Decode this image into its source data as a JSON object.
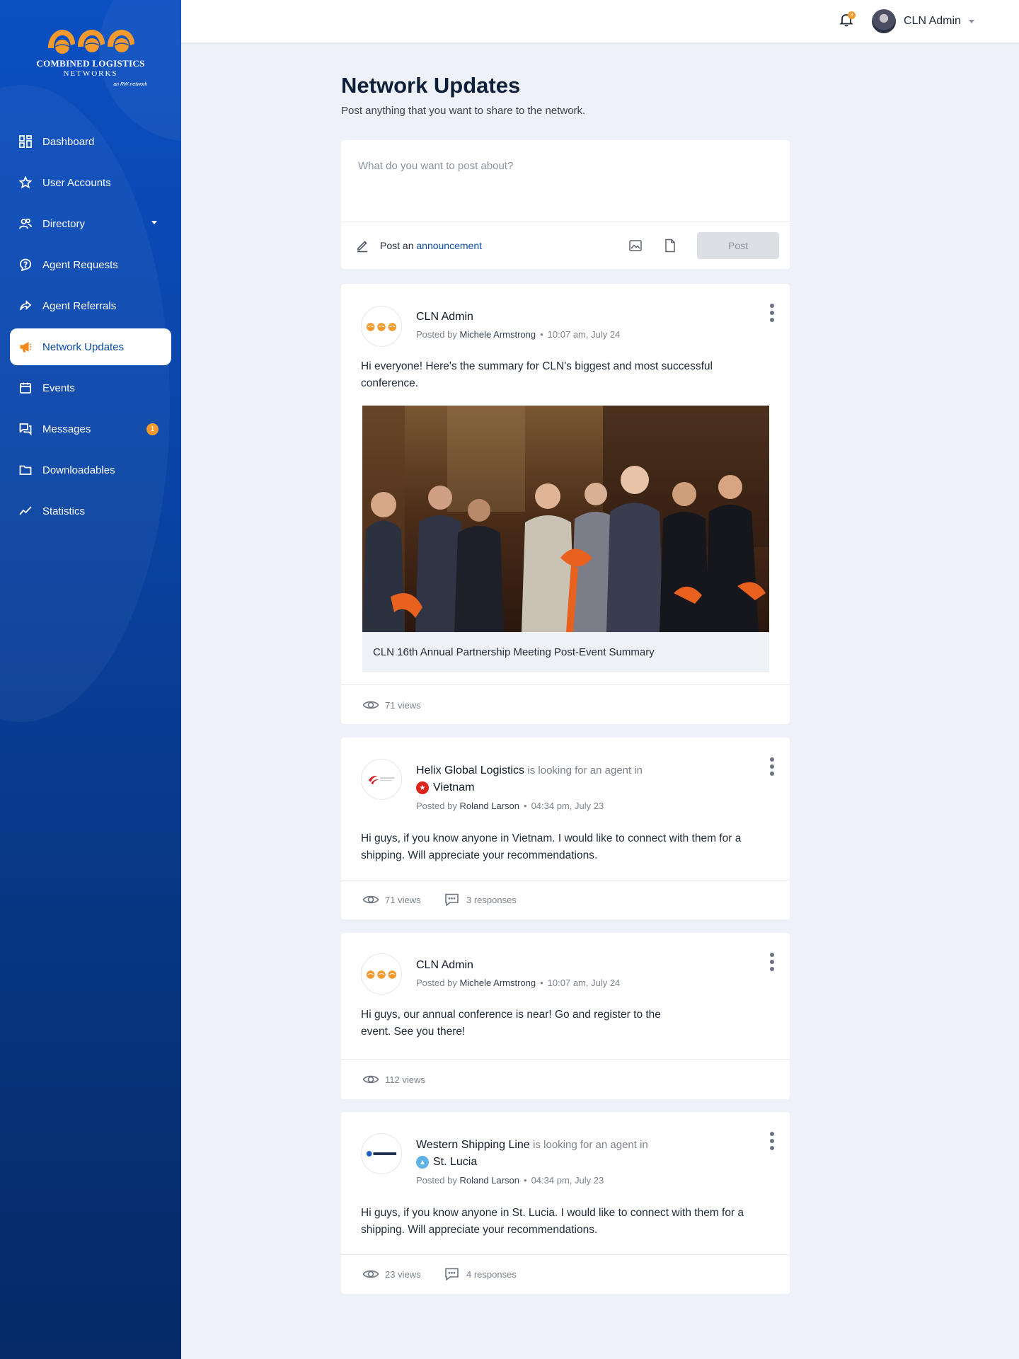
{
  "brand": {
    "line1": "COMBINED LOGISTICS",
    "line2": "NETWORKS",
    "line3": "an RW network"
  },
  "sidebar": {
    "items": [
      {
        "label": "Dashboard",
        "icon": "dashboard-icon"
      },
      {
        "label": "User Accounts",
        "icon": "star-icon"
      },
      {
        "label": "Directory",
        "icon": "people-icon"
      },
      {
        "label": "Agent Requests",
        "icon": "question-circle-icon"
      },
      {
        "label": "Agent Referrals",
        "icon": "share-arrow-icon"
      },
      {
        "label": "Network Updates",
        "icon": "megaphone-icon"
      },
      {
        "label": "Events",
        "icon": "calendar-icon"
      },
      {
        "label": "Messages",
        "icon": "chat-icon",
        "badge": "1"
      },
      {
        "label": "Downloadables",
        "icon": "folder-icon"
      },
      {
        "label": "Statistics",
        "icon": "trend-line-icon"
      }
    ],
    "active": "Network Updates"
  },
  "topbar": {
    "notification_count": "3",
    "user_name": "CLN Admin"
  },
  "page": {
    "title": "Network Updates",
    "subtitle": "Post anything that you want to share to the network."
  },
  "composer": {
    "placeholder": "What do you want to post about?",
    "announce_prefix": "Post an",
    "announce_link": "announcement",
    "post_label": "Post"
  },
  "posts": [
    {
      "author": "CLN Admin",
      "posted_by_label": "Posted by",
      "posted_by": "Michele Armstrong",
      "time": "10:07 am, July 24",
      "body": "Hi everyone! Here's the summary for CLN's biggest and most successful conference.",
      "caption": "CLN 16th Annual Partnership Meeting Post-Event Summary",
      "views": "71 views"
    },
    {
      "author": "Helix Global Logistics",
      "looking": "is looking for an agent in",
      "country": "Vietnam",
      "posted_by_label": "Posted by",
      "posted_by": "Roland Larson",
      "time": "04:34 pm, July 23",
      "body": "Hi guys, if you know anyone in Vietnam. I would like to connect with them for a shipping. Will appreciate your recommendations.",
      "views": "71 views",
      "responses": "3 responses"
    },
    {
      "author": "CLN Admin",
      "posted_by_label": "Posted by",
      "posted_by": "Michele Armstrong",
      "time": "10:07 am, July 24",
      "body": "Hi guys, our annual conference is near! Go and register to the event. See you there!",
      "views": "112 views"
    },
    {
      "author": "Western Shipping Line",
      "looking": "is looking for an agent in",
      "country": "St. Lucia",
      "posted_by_label": "Posted by",
      "posted_by": "Roland Larson",
      "time": "04:34 pm, July 23",
      "body": "Hi guys, if you know anyone in St. Lucia. I would like to connect with them for a shipping. Will appreciate your recommendations.",
      "views": "23 views",
      "responses": "4 responses"
    }
  ],
  "colors": {
    "accent": "#f18a1c",
    "primary": "#0a4aa8",
    "sidebar_top": "#0b4fc2",
    "sidebar_bottom": "#052a66"
  }
}
